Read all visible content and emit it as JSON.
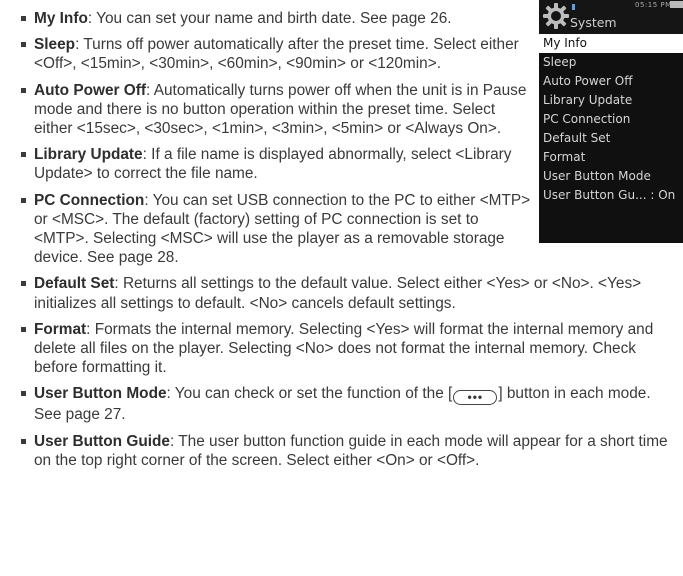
{
  "device": {
    "title": "System",
    "time": "05:15 PM",
    "menu": [
      "My Info",
      "Sleep",
      "Auto Power Off",
      "Library Update",
      "PC Connection",
      "Default Set",
      "Format",
      "User Button Mode",
      "User Button Gu... : On"
    ]
  },
  "items": [
    {
      "term": "My Info",
      "text": ": You can set your name and birth date. See page 26."
    },
    {
      "term": "Sleep",
      "text": ": Turns off power automatically after the preset time. Select either <Off>, <15min>, <30min>, <60min>, <90min> or <120min>."
    },
    {
      "term": "Auto Power Off",
      "text": ": Automatically turns power off when the unit is in Pause mode and there is no button operation within the preset time. Select either <15sec>, <30sec>, <1min>, <3min>, <5min> or <Always On>."
    },
    {
      "term": "Library Update",
      "text": ": If a file name is displayed abnormally, select <Library Update> to correct the file name."
    },
    {
      "term": "PC Connection",
      "text": ": You can set USB connection to the PC to either <MTP> or <MSC>. The default (factory) setting of PC connection is set to <MTP>. Selecting <MSC> will use the player as a removable storage device. See page 28."
    },
    {
      "term": "Default Set",
      "text": ": Returns all settings to the default value. Select either <Yes> or <No>. <Yes> initializes all settings to default. <No> cancels default settings."
    },
    {
      "term": "Format",
      "text": ": Formats the internal memory. Selecting <Yes> will format the internal memory and delete all files on the player. Selecting <No> does not format the internal memory. Check before formatting it."
    },
    {
      "term": "User Button Mode",
      "text_before": ": You can check or set the function of the [",
      "button": "•••",
      "text_after": "] button in each mode. See page 27."
    },
    {
      "term": "User Button Guide",
      "text": ": The user button function guide in each mode will appear for a short time on the top right corner of the screen. Select either <On> or <Off>."
    }
  ]
}
